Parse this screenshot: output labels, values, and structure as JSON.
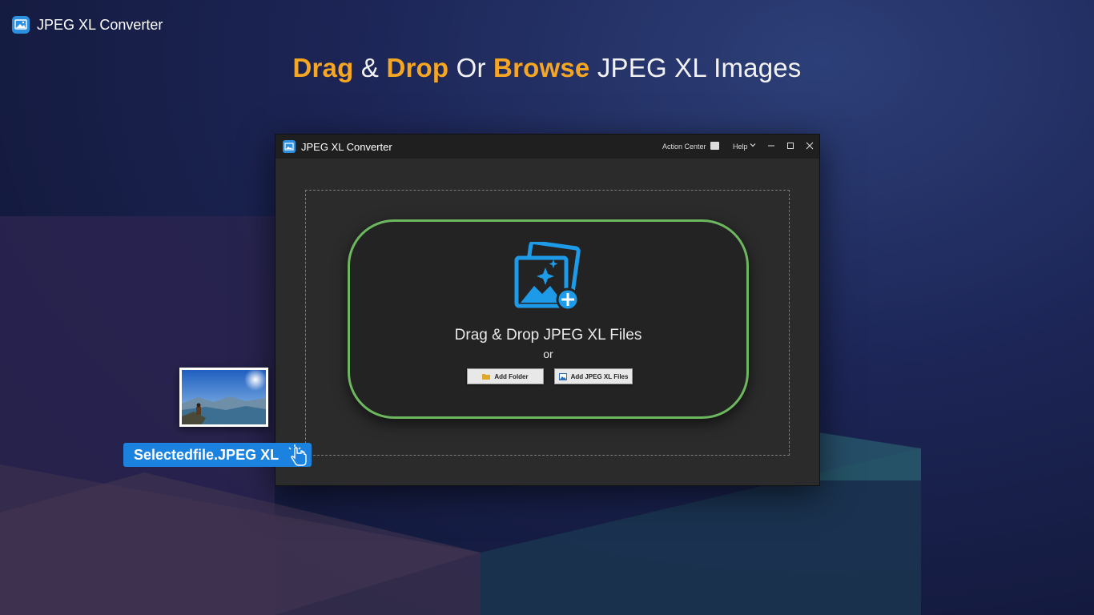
{
  "brand": {
    "title": "JPEG XL Converter"
  },
  "headline": {
    "part1": "Drag",
    "part2": "&",
    "part3": "Drop",
    "part4": "Or",
    "part5": "Browse",
    "part6": "JPEG XL Images"
  },
  "window": {
    "title": "JPEG XL Converter",
    "action_center": "Action Center",
    "help": "Help"
  },
  "drop_zone": {
    "title": "Drag & Drop JPEG XL Files",
    "or": "or",
    "add_folder": "Add Folder",
    "add_files": "Add JPEG XL Files"
  },
  "dragged_file": {
    "name": "Selectedfile.JPEG XL"
  },
  "icons": {
    "brand": "gallery-icon",
    "action_center": "gift-icon",
    "help": "chevron-down-icon",
    "drop": "gallery-add-icon",
    "folder": "folder-icon",
    "image": "image-icon",
    "cursor": "hand-pointer-icon"
  },
  "colors": {
    "accent": "#f5a623",
    "drop_border": "#6db85f",
    "file_label": "#1b82e0",
    "icon_blue": "#2d8fe0"
  }
}
